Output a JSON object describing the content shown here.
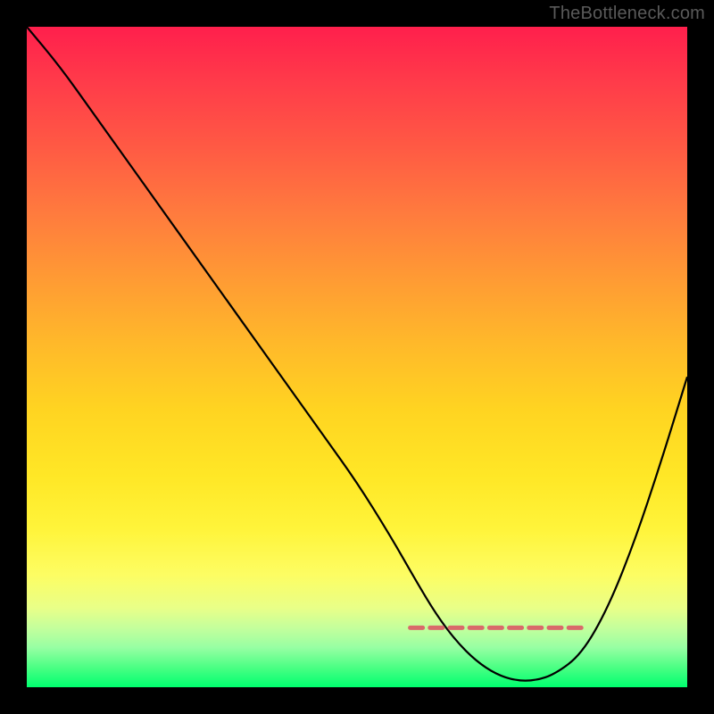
{
  "watermark": "TheBottleneck.com",
  "colors": {
    "page_bg": "#000000",
    "curve_stroke": "#000000",
    "marker_stroke": "#d96a6a",
    "watermark_text": "#5a5a5a"
  },
  "chart_data": {
    "type": "line",
    "title": "",
    "xlabel": "",
    "ylabel": "",
    "xlim": [
      0,
      100
    ],
    "ylim": [
      0,
      100
    ],
    "grid": false,
    "series": [
      {
        "name": "bottleneck-curve",
        "x": [
          0,
          5,
          10,
          15,
          20,
          25,
          30,
          35,
          40,
          45,
          50,
          55,
          59,
          62,
          65,
          68,
          71,
          74,
          77,
          80,
          84,
          88,
          92,
          96,
          100
        ],
        "y": [
          100,
          94,
          87,
          80,
          73,
          66,
          59,
          52,
          45,
          38,
          31,
          23,
          16,
          11,
          7,
          4,
          2,
          1,
          1,
          2,
          5,
          12,
          22,
          34,
          47
        ]
      }
    ],
    "markers": {
      "name": "optimal-range",
      "style": "dashed",
      "x": [
        59,
        62,
        65,
        68,
        71,
        74,
        77,
        80,
        83
      ],
      "y": [
        9,
        9,
        9,
        9,
        9,
        9,
        9,
        9,
        9
      ]
    },
    "gradient_note": "Vertical gradient background from red (top, high bottleneck) through orange and yellow to green (bottom, low bottleneck)."
  }
}
